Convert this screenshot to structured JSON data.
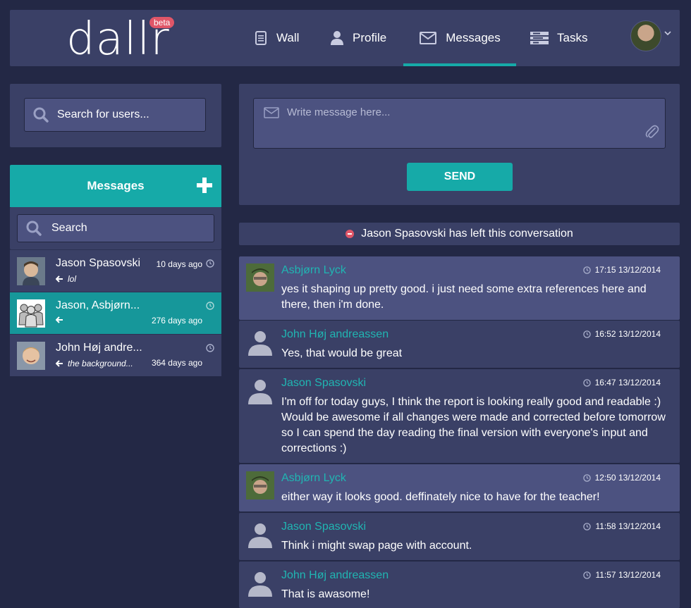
{
  "app": {
    "logo": "dallr",
    "badge": "beta"
  },
  "nav": [
    {
      "label": "Wall",
      "icon": "document-icon"
    },
    {
      "label": "Profile",
      "icon": "person-icon"
    },
    {
      "label": "Messages",
      "icon": "envelope-icon",
      "active": true
    },
    {
      "label": "Tasks",
      "icon": "tasks-icon"
    }
  ],
  "sidebar": {
    "user_search_placeholder": "Search for users...",
    "messages_title": "Messages",
    "list_search_placeholder": "Search",
    "conversations": [
      {
        "name": "Jason Spasovski",
        "time": "10 days ago",
        "preview": "lol"
      },
      {
        "name": "Jason, Asbjørn...",
        "time": "276 days ago",
        "preview": ""
      },
      {
        "name": "John Høj andre...",
        "time": "364 days ago",
        "preview": "the background..."
      }
    ]
  },
  "compose": {
    "placeholder": "Write message here...",
    "send_label": "SEND"
  },
  "notice": "Jason Spasovski has left this conversation",
  "messages": [
    {
      "author": "Asbjørn Lyck",
      "time": "17:15 13/12/2014",
      "body": "yes it shaping up pretty good. i just need some extra references here and there, then i'm done."
    },
    {
      "author": "John Høj andreassen",
      "time": "16:52 13/12/2014",
      "body": "Yes, that would be great"
    },
    {
      "author": "Jason Spasovski",
      "time": "16:47 13/12/2014",
      "body": "I'm off for today guys, I think the report is looking really good and readable :) Would be awesome if all changes were made and corrected before tomorrow so I can spend the day reading the final version with everyone's input and corrections :)"
    },
    {
      "author": "Asbjørn Lyck",
      "time": "12:50 13/12/2014",
      "body": "either way it looks good. deffinately nice to have for the teacher!"
    },
    {
      "author": "Jason Spasovski",
      "time": "11:58 13/12/2014",
      "body": "Think i might swap page with account."
    },
    {
      "author": "John Høj andreassen",
      "time": "11:57 13/12/2014",
      "body": "That is awasome!"
    }
  ],
  "colors": {
    "background": "#232845",
    "panel": "#3a4066",
    "accent": "#16aaa8",
    "author": "#20b5b2",
    "badge": "#e05668"
  }
}
